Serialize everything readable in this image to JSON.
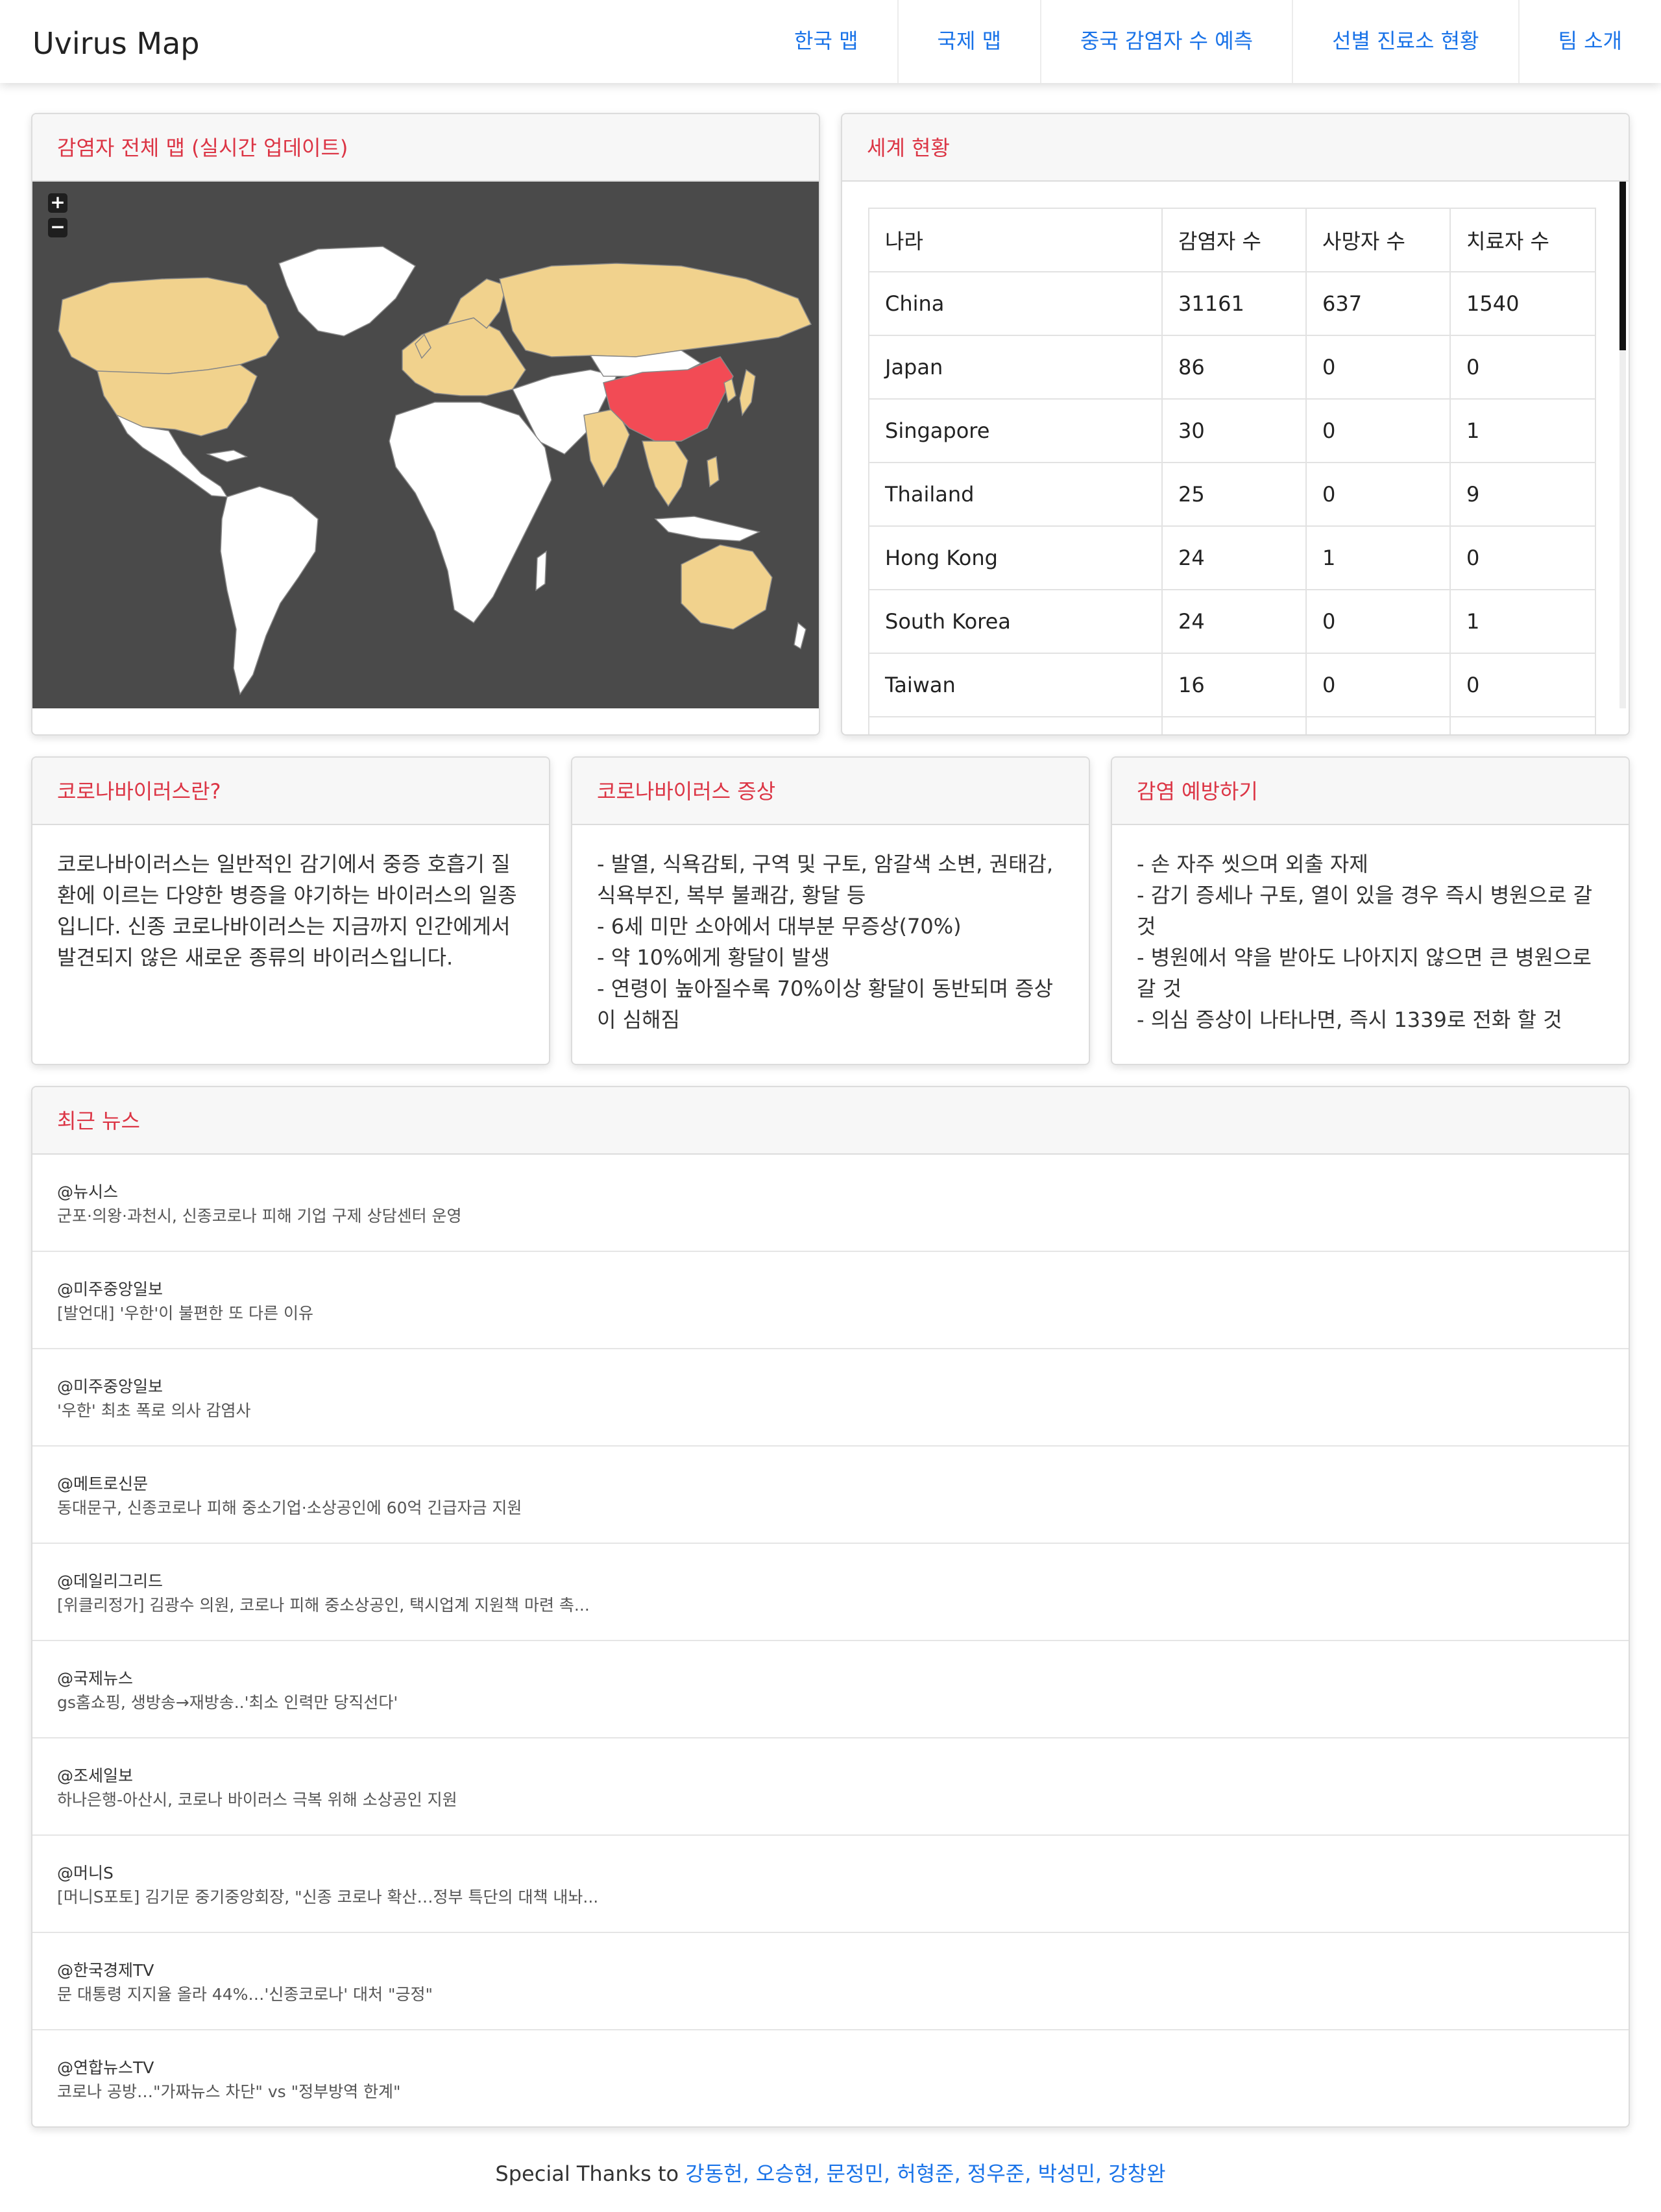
{
  "navbar": {
    "brand": "Uvirus Map",
    "links": [
      "한국 맵",
      "국제 맵",
      "중국 감염자 수 예측",
      "선별 진료소 현황",
      "팀 소개"
    ]
  },
  "map_card": {
    "title": "감염자 전체 맵 (실시간 업데이트)",
    "zoom_in": "+",
    "zoom_out": "−",
    "colors": {
      "ocean": "#4a4a4a",
      "high": "#f24b55",
      "medium": "#f1d28d",
      "none": "#ffffff"
    }
  },
  "world_card": {
    "title": "세계 현황",
    "headers": [
      "나라",
      "감염자 수",
      "사망자 수",
      "치료자 수"
    ],
    "rows": [
      [
        "China",
        "31161",
        "637",
        "1540"
      ],
      [
        "Japan",
        "86",
        "0",
        "0"
      ],
      [
        "Singapore",
        "30",
        "0",
        "1"
      ],
      [
        "Thailand",
        "25",
        "0",
        "9"
      ],
      [
        "Hong Kong",
        "24",
        "1",
        "0"
      ],
      [
        "South Korea",
        "24",
        "0",
        "1"
      ],
      [
        "Taiwan",
        "16",
        "0",
        "0"
      ]
    ]
  },
  "info_cards": [
    {
      "title": "코로나바이러스란?",
      "lines": [
        "코로나바이러스는 일반적인 감기에서 중증 호흡기 질",
        "환에 이르는 다양한 병증을 야기하는 바이러스의 일종",
        "입니다. 신종 코로나바이러스는 지금까지 인간에게서",
        "발견되지 않은 새로운 종류의 바이러스입니다."
      ]
    },
    {
      "title": "코로나바이러스 증상",
      "lines": [
        "- 발열, 식욕감퇴, 구역 및 구토, 암갈색 소변, 권태감,",
        "식욕부진, 복부 불쾌감, 황달 등",
        "- 6세 미만 소아에서 대부분 무증상(70%)",
        "- 약 10%에게 황달이 발생",
        "- 연령이 높아질수록 70%이상 황달이 동반되며 증상",
        "이 심해짐"
      ]
    },
    {
      "title": "감염 예방하기",
      "lines": [
        "- 손 자주 씻으며 외출 자제",
        "- 감기 증세나 구토, 열이 있을 경우 즉시 병원으로 갈",
        "것",
        "- 병원에서 약을 받아도 나아지지 않으면 큰 병원으로",
        "갈 것",
        "- 의심 증상이 나타나면, 즉시 1339로 전화 할 것"
      ]
    }
  ],
  "news_card": {
    "title": "최근 뉴스",
    "items": [
      {
        "source": "@뉴시스",
        "title": "군포·의왕·과천시, 신종코로나 피해 기업 구제 상담센터 운영"
      },
      {
        "source": "@미주중앙일보",
        "title": "[발언대] '우한'이 불편한 또 다른 이유"
      },
      {
        "source": "@미주중앙일보",
        "title": "'우한' 최초 폭로 의사 감염사"
      },
      {
        "source": "@메트로신문",
        "title": "동대문구, 신종코로나 피해 중소기업·소상공인에 60억 긴급자금 지원"
      },
      {
        "source": "@데일리그리드",
        "title": "[위클리정가] 김광수 의원, 코로나 피해 중소상공인, 택시업계 지원책 마련 촉..."
      },
      {
        "source": "@국제뉴스",
        "title": "gs홈쇼핑, 생방송→재방송..'최소 인력만 당직선다'"
      },
      {
        "source": "@조세일보",
        "title": "하나은행-아산시, 코로나 바이러스 극복 위해 소상공인 지원"
      },
      {
        "source": "@머니S",
        "title": "[머니S포토] 김기문 중기중앙회장, \"신종 코로나 확산…정부 특단의 대책 내놔..."
      },
      {
        "source": "@한국경제TV",
        "title": "문 대통령 지지율 올라 44%…'신종코로나' 대처 \"긍정\""
      },
      {
        "source": "@연합뉴스TV",
        "title": "코로나 공방…\"가짜뉴스 차단\" vs \"정부방역 한계\""
      }
    ]
  },
  "footer": {
    "prefix": "Special Thanks to ",
    "names": "강동헌, 오승현, 문정민, 허형준, 정우준, 박성민, 강창완"
  }
}
